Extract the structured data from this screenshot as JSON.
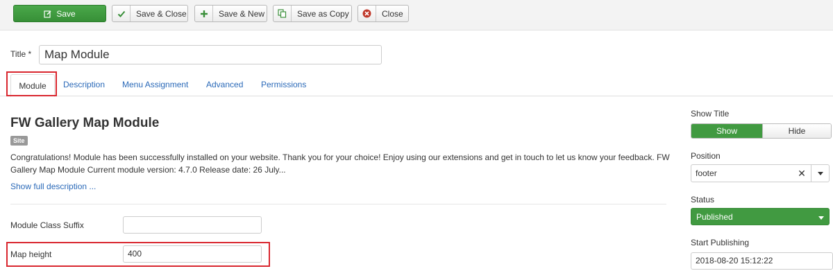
{
  "toolbar": {
    "save_label": "Save",
    "save_close_label": "Save & Close",
    "save_new_label": "Save & New",
    "save_copy_label": "Save as Copy",
    "close_label": "Close"
  },
  "title_field": {
    "label": "Title *",
    "value": "Map Module"
  },
  "tabs": [
    {
      "label": "Module",
      "active": true
    },
    {
      "label": "Description"
    },
    {
      "label": "Menu Assignment"
    },
    {
      "label": "Advanced"
    },
    {
      "label": "Permissions"
    }
  ],
  "module": {
    "heading": "FW Gallery Map Module",
    "badge": "Site",
    "description": "Congratulations! Module has been successfully installed on your website. Thank you for your choice! Enjoy using our extensions and get in touch to let us know your feedback. FW Gallery Map Module Current module version: 4.7.0 Release date: 26 July...",
    "show_full_link": "Show full description ..."
  },
  "fields": {
    "class_suffix": {
      "label": "Module Class Suffix",
      "value": ""
    },
    "map_height": {
      "label": "Map height",
      "value": "400"
    }
  },
  "sidebar": {
    "show_title": {
      "label": "Show Title",
      "on_label": "Show",
      "off_label": "Hide",
      "selected": "Show"
    },
    "position": {
      "label": "Position",
      "value": "footer"
    },
    "status": {
      "label": "Status",
      "value": "Published"
    },
    "start_publishing": {
      "label": "Start Publishing",
      "value": "2018-08-20 15:12:22"
    }
  },
  "colors": {
    "primary_green": "#419a41",
    "link_blue": "#2a69b8",
    "highlight_red": "#d9262e"
  }
}
